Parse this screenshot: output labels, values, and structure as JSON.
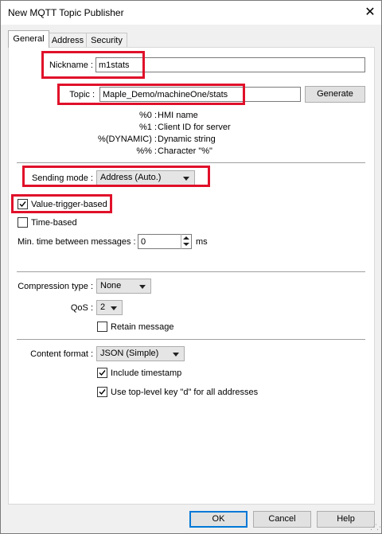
{
  "window": {
    "title": "New MQTT Topic Publisher",
    "close_glyph": "✕"
  },
  "tabs": [
    {
      "label": "General",
      "active": true
    },
    {
      "label": "Address",
      "active": false
    },
    {
      "label": "Security",
      "active": false
    }
  ],
  "general": {
    "nickname_label": "Nickname :",
    "nickname_value": "m1stats",
    "topic_label": "Topic :",
    "topic_value": "Maple_Demo/machineOne/stats",
    "generate_label": "Generate",
    "hints": [
      {
        "code": "%0 :",
        "desc": "HMI name"
      },
      {
        "code": "%1 :",
        "desc": "Client ID for server"
      },
      {
        "code": "%(DYNAMIC) :",
        "desc": "Dynamic string"
      },
      {
        "code": "%% :",
        "desc": "Character \"%\""
      }
    ],
    "sending_mode_label": "Sending mode :",
    "sending_mode_value": "Address (Auto.)",
    "value_trigger_label": "Value-trigger-based",
    "value_trigger_checked": true,
    "time_based_label": "Time-based",
    "time_based_checked": false,
    "min_time_label": "Min. time between messages :",
    "min_time_value": "0",
    "min_time_unit": "ms",
    "compression_label": "Compression type :",
    "compression_value": "None",
    "qos_label": "QoS :",
    "qos_value": "2",
    "retain_label": "Retain message",
    "retain_checked": false,
    "content_format_label": "Content format :",
    "content_format_value": "JSON (Simple)",
    "include_timestamp_label": "Include timestamp",
    "include_timestamp_checked": true,
    "top_level_key_label": "Use top-level key \"d\" for all addresses",
    "top_level_key_checked": true
  },
  "footer": {
    "ok_label": "OK",
    "cancel_label": "Cancel",
    "help_label": "Help"
  },
  "colors": {
    "highlight_red": "#e0102a",
    "accent_blue": "#0078d7"
  },
  "icons": {
    "check": "check-icon",
    "close": "close-icon",
    "dropdown": "chevron-down-icon",
    "spinner": "spinner-arrows-icon"
  }
}
